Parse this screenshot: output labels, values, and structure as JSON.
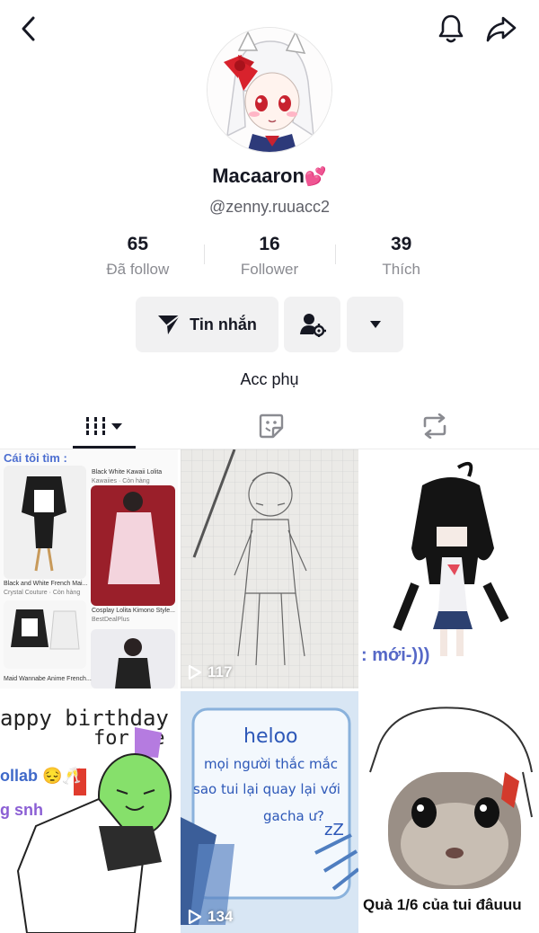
{
  "profile": {
    "display_name": "Macaaron",
    "handle": "@zenny.ruuacc2",
    "bio": "Acc phụ"
  },
  "stats": [
    {
      "value": "65",
      "label": "Đã follow"
    },
    {
      "value": "16",
      "label": "Follower"
    },
    {
      "value": "39",
      "label": "Thích"
    }
  ],
  "actions": {
    "message_label": "Tin nhắn"
  },
  "icons": {
    "back": "chevron-left-icon",
    "bell": "bell-icon",
    "share": "share-icon",
    "message": "send-icon",
    "add_friend": "person-settings-icon",
    "more": "caret-down-icon",
    "videos_tab": "grid-icon",
    "favorites_tab": "sticker-icon",
    "reposts_tab": "repost-icon",
    "play": "play-icon"
  },
  "videos": [
    {
      "views": "",
      "texts": {
        "header": "Cái tôi tìm :",
        "item1_title": "Black and White French Mai...",
        "item1_shop": "Crystal Couture · Còn hàng",
        "item2_title": "Black White Kawaii Lolita",
        "item2_shop": "Kawaiies · Còn hàng",
        "item3_title": "Cosplay Lolita Kimono Style...",
        "item3_shop": "BestDealPlus",
        "item4_title": "Maid Wannabe Anime French..."
      }
    },
    {
      "views": "117"
    },
    {
      "views": "",
      "caption": ": mới-)))"
    },
    {
      "views": "",
      "caption_line1": "appy birthday",
      "caption_line2": "for me",
      "caption_line3": "ollab 😔🥂",
      "caption_line4": "g snh"
    },
    {
      "views": "134",
      "caption_line1": "heloo",
      "caption_line2": "mọi người thắc mắc",
      "caption_line3": "sao tui lại quay lại với",
      "caption_line4": "gacha ư?"
    },
    {
      "views": "",
      "caption": "Quà 1/6 của tui đâuuu"
    }
  ],
  "colors": {
    "text_primary": "#161823",
    "text_secondary": "#8a8b91",
    "button_bg": "#f1f1f2",
    "heart": "#ff3ea5"
  }
}
